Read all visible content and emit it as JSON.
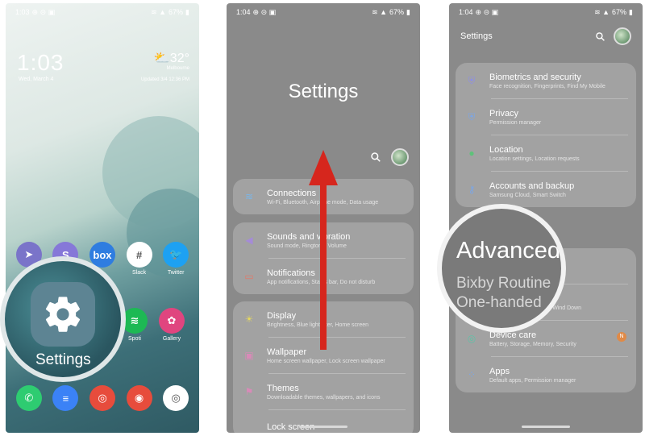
{
  "phone1": {
    "status": {
      "time": "1:03",
      "battery": "67%"
    },
    "clock": "1:03",
    "date": "Wed, March 4",
    "weather": {
      "temp": "32°",
      "city": "Melbourne",
      "updated": "Updated 3/4 12:36 PM"
    },
    "apps_row1": [
      {
        "label": "Ne",
        "color": "#7a74c9",
        "glyph": "➤"
      },
      {
        "label": "",
        "color": "#8678d8",
        "glyph": "S"
      },
      {
        "label": "",
        "color": "#2f7de0",
        "glyph": "box"
      },
      {
        "label": "Slack",
        "color": "#ffffff",
        "glyph": "#"
      },
      {
        "label": "Twitter",
        "color": "#1da1f2",
        "glyph": "🐦"
      }
    ],
    "apps_row2": [
      {
        "label": "Spoti",
        "color": "#1db954",
        "glyph": "≋"
      },
      {
        "label": "Gallery",
        "color": "#e0457f",
        "glyph": "✿"
      }
    ],
    "dock": [
      {
        "label": "",
        "color": "#2ecc71",
        "glyph": "✆"
      },
      {
        "label": "",
        "color": "#3b82f6",
        "glyph": "≡"
      },
      {
        "label": "",
        "color": "#e74c3c",
        "glyph": "◎"
      },
      {
        "label": "",
        "color": "#e74c3c",
        "glyph": "◉"
      },
      {
        "label": "",
        "color": "#ffffff",
        "glyph": "◎"
      }
    ],
    "magnified_label": "Settings"
  },
  "phone2": {
    "status": {
      "time": "1:04",
      "battery": "67%"
    },
    "title": "Settings",
    "card1": [
      {
        "title": "Connections",
        "sub": "Wi-Fi, Bluetooth, Airplane mode, Data usage",
        "icon": "wifi-icon",
        "glyph": "≋",
        "color": "#7bb6e8"
      }
    ],
    "card2": [
      {
        "title": "Sounds and vibration",
        "sub": "Sound mode, Ringtone, Volume",
        "icon": "volume-icon",
        "glyph": "◀",
        "color": "#a58bd8"
      },
      {
        "title": "Notifications",
        "sub": "App notifications, Status bar, Do not disturb",
        "icon": "notifications-icon",
        "glyph": "▭",
        "color": "#e07a6a"
      }
    ],
    "card3": [
      {
        "title": "Display",
        "sub": "Brightness, Blue light filter, Home screen",
        "icon": "display-icon",
        "glyph": "☀",
        "color": "#e6d85e"
      },
      {
        "title": "Wallpaper",
        "sub": "Home screen wallpaper, Lock screen wallpaper",
        "icon": "wallpaper-icon",
        "glyph": "▣",
        "color": "#d88ab8"
      },
      {
        "title": "Themes",
        "sub": "Downloadable themes, wallpapers, and icons",
        "icon": "themes-icon",
        "glyph": "⚑",
        "color": "#d88ab8"
      },
      {
        "title": "Lock screen",
        "sub": "",
        "icon": "lock-icon",
        "glyph": "",
        "color": "#9fb0c8"
      }
    ]
  },
  "phone3": {
    "status": {
      "time": "1:04",
      "battery": "67%"
    },
    "title": "Settings",
    "card1": [
      {
        "title": "Biometrics and security",
        "sub": "Face recognition, Fingerprints, Find My Mobile",
        "icon": "shield-icon",
        "glyph": "⛨",
        "color": "#8c8ee8"
      },
      {
        "title": "Privacy",
        "sub": "Permission manager",
        "icon": "privacy-icon",
        "glyph": "⛨",
        "color": "#7aa6e8"
      },
      {
        "title": "Location",
        "sub": "Location settings, Location requests",
        "icon": "location-icon",
        "glyph": "●",
        "color": "#5ec27a"
      },
      {
        "title": "Accounts and backup",
        "sub": "Samsung Cloud, Smart Switch",
        "icon": "key-icon",
        "glyph": "⚷",
        "color": "#7aa6e8"
      }
    ],
    "card2": [
      {
        "title": "",
        "sub": "gestures,",
        "icon": "advanced-icon",
        "glyph": "",
        "color": "#e6c25e"
      },
      {
        "title": "ng and parental",
        "sub": "Screen time, App timers, Wind Down",
        "icon": "wellbeing-icon",
        "glyph": "◔",
        "color": "#5ec27a"
      },
      {
        "title": "Device care",
        "sub": "Battery, Storage, Memory, Security",
        "icon": "device-care-icon",
        "glyph": "◎",
        "color": "#5ec2a8"
      },
      {
        "title": "Apps",
        "sub": "Default apps, Permission manager",
        "icon": "apps-icon",
        "glyph": "⁘",
        "color": "#7aa6e8"
      }
    ],
    "badge": "N",
    "magnified": {
      "title": "Advanced",
      "line1": "Bixby Routine",
      "line2": "One-handed"
    }
  }
}
